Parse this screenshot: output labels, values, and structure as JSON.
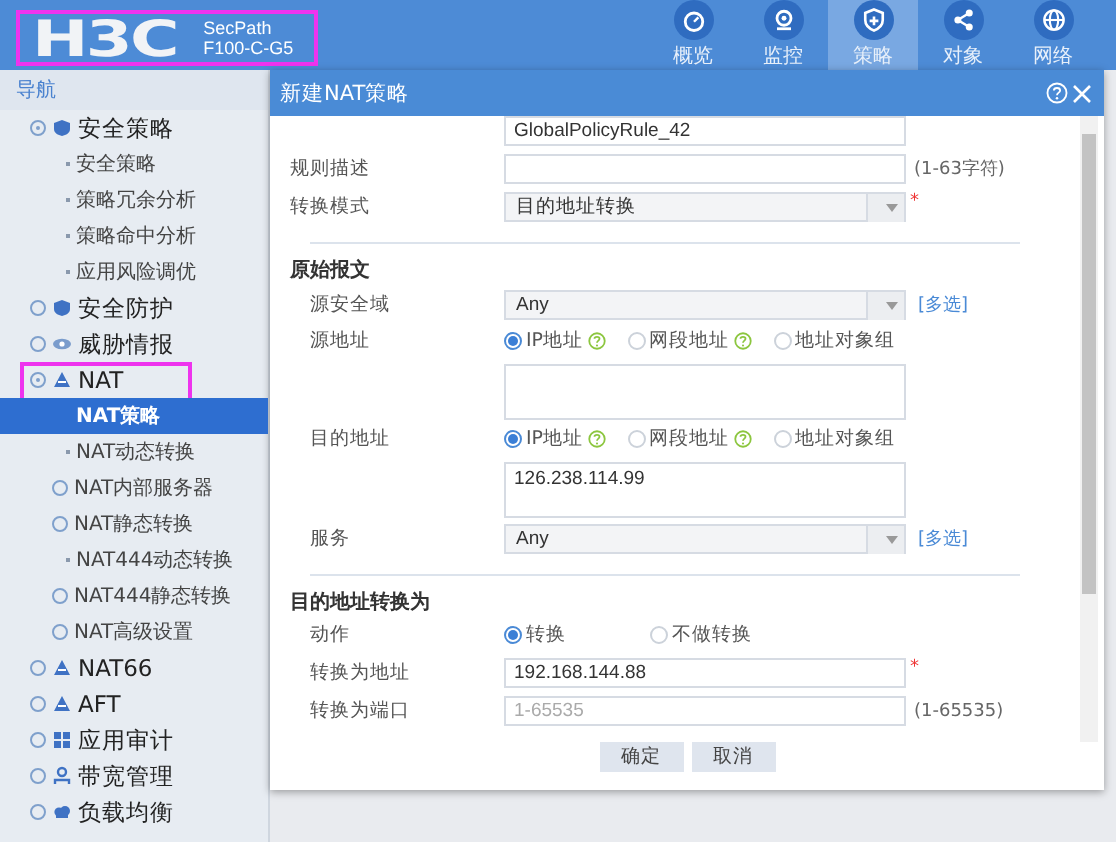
{
  "header": {
    "logo": "H3C",
    "product_line": "SecPath",
    "model": "F100-C-G5",
    "highlighted": true,
    "nav": [
      {
        "label": "概览",
        "selected": false
      },
      {
        "label": "监控",
        "selected": false
      },
      {
        "label": "策略",
        "selected": true
      },
      {
        "label": "对象",
        "selected": false
      },
      {
        "label": "网络",
        "selected": false
      }
    ]
  },
  "sidebar": {
    "title": "导航",
    "items": [
      {
        "label": "安全策略",
        "expanded": true,
        "selected": false,
        "children": [
          {
            "label": "安全策略",
            "selected": false
          },
          {
            "label": "策略冗余分析",
            "selected": false
          },
          {
            "label": "策略命中分析",
            "selected": false
          },
          {
            "label": "应用风险调优",
            "selected": false
          }
        ]
      },
      {
        "label": "安全防护",
        "expanded": false,
        "selected": false
      },
      {
        "label": "威胁情报",
        "expanded": false,
        "selected": false
      },
      {
        "label": "NAT",
        "expanded": true,
        "selected": false,
        "highlighted": true,
        "children": [
          {
            "label": "NAT策略",
            "selected": true
          },
          {
            "label": "NAT动态转换",
            "selected": false
          },
          {
            "label": "NAT内部服务器",
            "expanded": false,
            "selected": false
          },
          {
            "label": "NAT静态转换",
            "expanded": false,
            "selected": false
          },
          {
            "label": "NAT444动态转换",
            "selected": false
          },
          {
            "label": "NAT444静态转换",
            "expanded": false,
            "selected": false
          },
          {
            "label": "NAT高级设置",
            "expanded": false,
            "selected": false
          }
        ]
      },
      {
        "label": "NAT66",
        "expanded": false,
        "selected": false
      },
      {
        "label": "AFT",
        "expanded": false,
        "selected": false
      },
      {
        "label": "应用审计",
        "expanded": false,
        "selected": false
      },
      {
        "label": "带宽管理",
        "expanded": false,
        "selected": false
      },
      {
        "label": "负载均衡",
        "expanded": false,
        "selected": false
      }
    ]
  },
  "dialog": {
    "title": "新建NAT策略",
    "rows": [
      {
        "kind": "field",
        "value": "GlobalPolicyRule_42"
      },
      {
        "kind": "field",
        "label": "规则描述",
        "hint": "(1-63字符)"
      },
      {
        "kind": "select",
        "label": "转换模式",
        "value": "目的地址转换",
        "required_mark": "*"
      },
      {
        "kind": "divider"
      },
      {
        "kind": "section",
        "label": "原始报文"
      },
      {
        "kind": "select",
        "label": "源安全域",
        "value": "Any",
        "link": "[多选]"
      },
      {
        "kind": "radio",
        "label": "源地址",
        "options": [
          {
            "label": "IP地址",
            "selected": true,
            "help": true
          },
          {
            "label": "网段地址",
            "selected": false,
            "help": true
          },
          {
            "label": "地址对象组",
            "selected": false
          }
        ]
      },
      {
        "kind": "textarea"
      },
      {
        "kind": "radio",
        "label": "目的地址",
        "options": [
          {
            "label": "IP地址",
            "selected": true,
            "help": true
          },
          {
            "label": "网段地址",
            "selected": false,
            "help": true
          },
          {
            "label": "地址对象组",
            "selected": false
          }
        ]
      },
      {
        "kind": "textarea",
        "value": "126.238.114.99"
      },
      {
        "kind": "select",
        "label": "服务",
        "value": "Any",
        "link": "[多选]"
      },
      {
        "kind": "divider"
      },
      {
        "kind": "section",
        "label": "目的地址转换为"
      },
      {
        "kind": "radio",
        "label": "动作",
        "options": [
          {
            "label": "转换",
            "selected": true
          },
          {
            "label": "不做转换",
            "selected": false
          }
        ]
      },
      {
        "kind": "field",
        "label": "转换为地址",
        "value": "192.168.144.88",
        "required_mark": "*"
      },
      {
        "kind": "field",
        "label": "转换为端口",
        "placeholder": "1-65535",
        "hint": "(1-65535)"
      }
    ],
    "buttons": [
      "确定",
      "取消"
    ]
  }
}
